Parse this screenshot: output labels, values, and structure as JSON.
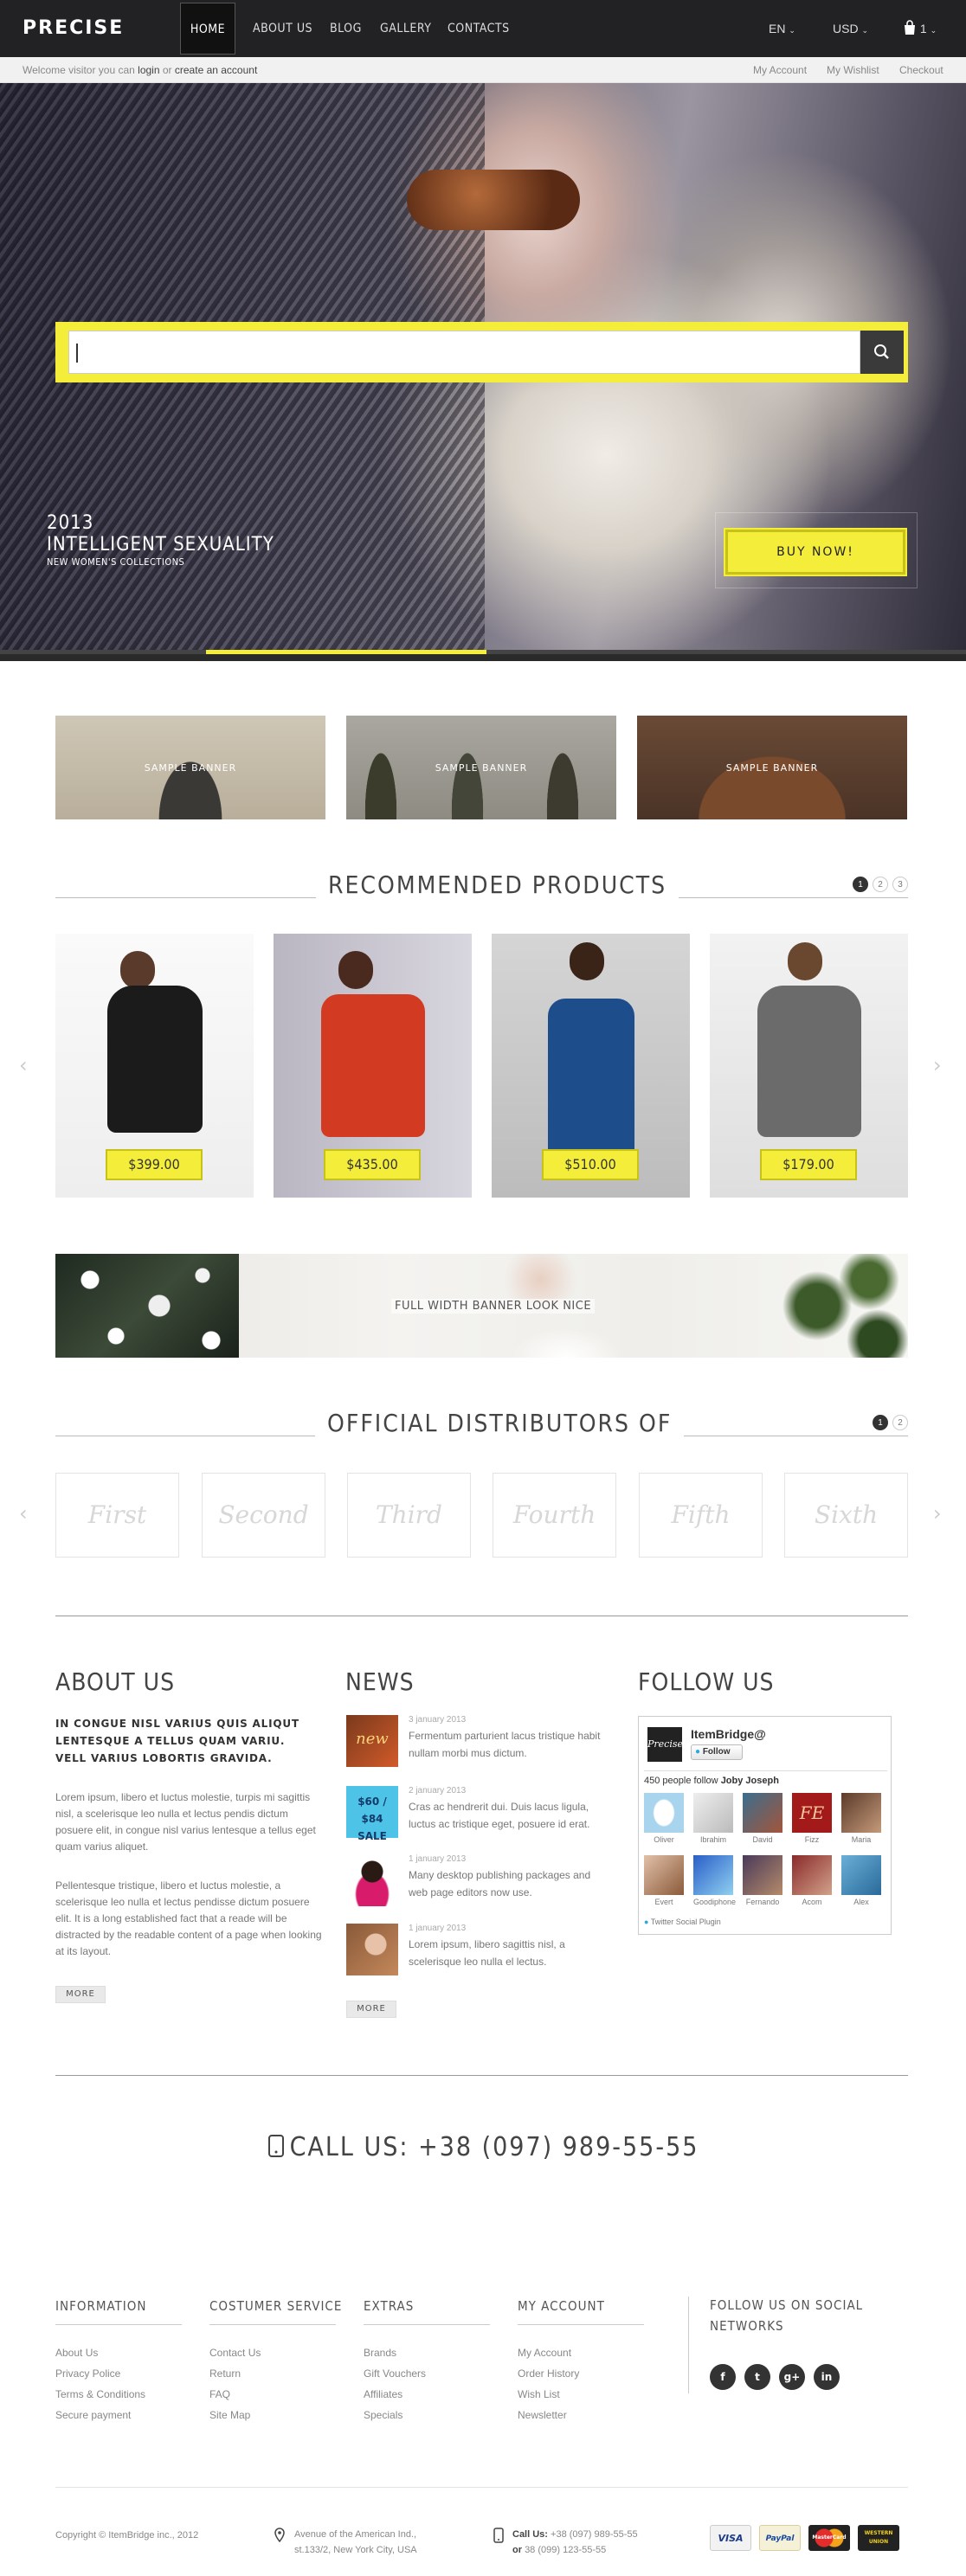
{
  "nav": {
    "logo": "PRECISE",
    "links": [
      "HOME",
      "ABOUT US",
      "BLOG",
      "GALLERY",
      "CONTACTS"
    ],
    "language": "EN",
    "currency": "USD",
    "cart_count": "1"
  },
  "subbar": {
    "welcome": "Welcome visitor you can",
    "login": "login",
    "or": "or",
    "create": "create an account",
    "my_account": "My Account",
    "wishlist": "My Wishlist",
    "checkout": "Checkout"
  },
  "hero": {
    "year": "2013",
    "title": "INTELLIGENT SEXUALITY",
    "subtitle": "NEW WOMEN'S COLLECTIONS",
    "buy_now": "BUY NOW!",
    "slider_progress": 0.29
  },
  "banners": [
    "SAMPLE BANNER",
    "SAMPLE BANNER",
    "SAMPLE BANNER"
  ],
  "recommended": {
    "title": "RECOMMENDED PRODUCTS",
    "pages": [
      "1",
      "2",
      "3"
    ],
    "products": [
      {
        "price": "$399.00"
      },
      {
        "price": "$435.00"
      },
      {
        "price": "$510.00"
      },
      {
        "price": "$179.00"
      }
    ]
  },
  "full_banner": "FULL WIDTH BANNER LOOK NICE",
  "distributors": {
    "title": "OFFICIAL DISTRIBUTORS OF",
    "pages": [
      "1",
      "2"
    ],
    "items": [
      "First",
      "Second",
      "Third",
      "Fourth",
      "Fifth",
      "Sixth"
    ]
  },
  "about": {
    "title": "ABOUT US",
    "lead": "IN CONGUE NISL VARIUS QUIS ALIQUT LENTESQUE A TELLUS QUAM  VARIU. VELL VARIUS LOBORTIS GRAVIDA.",
    "p1": "Lorem ipsum, libero et luctus molestie, turpis mi sagittis nisl, a scelerisque leo nulla et lectus pendis dictum posuere elit, in congue nisl varius lentesque a tellus eget quam varius aliquet.",
    "p2": "Pellentesque tristique, libero et luctus molestie, a scelerisque leo nulla et lectus pendisse dictum posuere elit. It is a long established fact that a reade will be distracted by the readable content of a page when looking at its layout.",
    "more": "MORE"
  },
  "news": {
    "title": "NEWS",
    "items": [
      {
        "date": "3 january 2013",
        "text": "Fermentum parturient lacus tristique habit nullam morbi  mus dictum."
      },
      {
        "date": "2 january 2013",
        "text": "Cras ac hendrerit dui. Duis lacus ligula, luctus ac tristique eget, posuere id erat."
      },
      {
        "date": "1 january 2013",
        "text": "Many desktop publishing packages and web page editors now use."
      },
      {
        "date": "1 january 2013",
        "text": "Lorem ipsum, libero sagittis nisl, a scelerisque leo nulla el lectus."
      }
    ],
    "thumb_texts": [
      "new",
      "$60 / $84 SALE"
    ],
    "more": "MORE"
  },
  "follow": {
    "title": "FOLLOW US",
    "widget_logo": "Precise",
    "account": "ItemBridge@",
    "follow_btn": "Follow",
    "count_text": "450 people follow",
    "count_name": "Joby Joseph",
    "followers": [
      "Oliver",
      "Ibrahim",
      "David",
      "Fizz",
      "Maria",
      "Evert",
      "Goodiphone",
      "Fernando",
      "Acom",
      "Alex"
    ],
    "plugin": "Twitter Social Plugin"
  },
  "callus": "CALL US: +38 (097) 989-55-55",
  "footer": {
    "columns": [
      {
        "title": "INFORMATION",
        "links": [
          "About Us",
          "Privacy Police",
          "Terms & Conditions",
          "Secure payment"
        ]
      },
      {
        "title": "COSTUMER SERVICE",
        "links": [
          "Contact Us",
          "Return",
          "FAQ",
          "Site Map"
        ]
      },
      {
        "title": "EXTRAS",
        "links": [
          "Brands",
          "Gift Vouchers",
          "Affiliates",
          "Specials"
        ]
      },
      {
        "title": "MY ACCOUNT",
        "links": [
          "My Account",
          "Order History",
          "Wish List",
          "Newsletter"
        ]
      }
    ],
    "social_title": "FOLLOW US ON SOCIAL NETWORKS",
    "social": [
      "f",
      "t",
      "g+",
      "in"
    ],
    "copyright": "Copyright © ItemBridge inc., 2012",
    "address1": "Avenue of the American Ind.,",
    "address2": "st.133/2, New York City, USA",
    "call_label": "Call Us:",
    "phone1": "+38 (097) 989-55-55",
    "or": "or",
    "phone2": "38 (099) 123-55-55",
    "cards": [
      "VISA",
      "PayPal",
      "MasterCard",
      "WESTERN UNION"
    ]
  },
  "colors": {
    "accent": "#f4ee3a",
    "dark": "#222224"
  }
}
